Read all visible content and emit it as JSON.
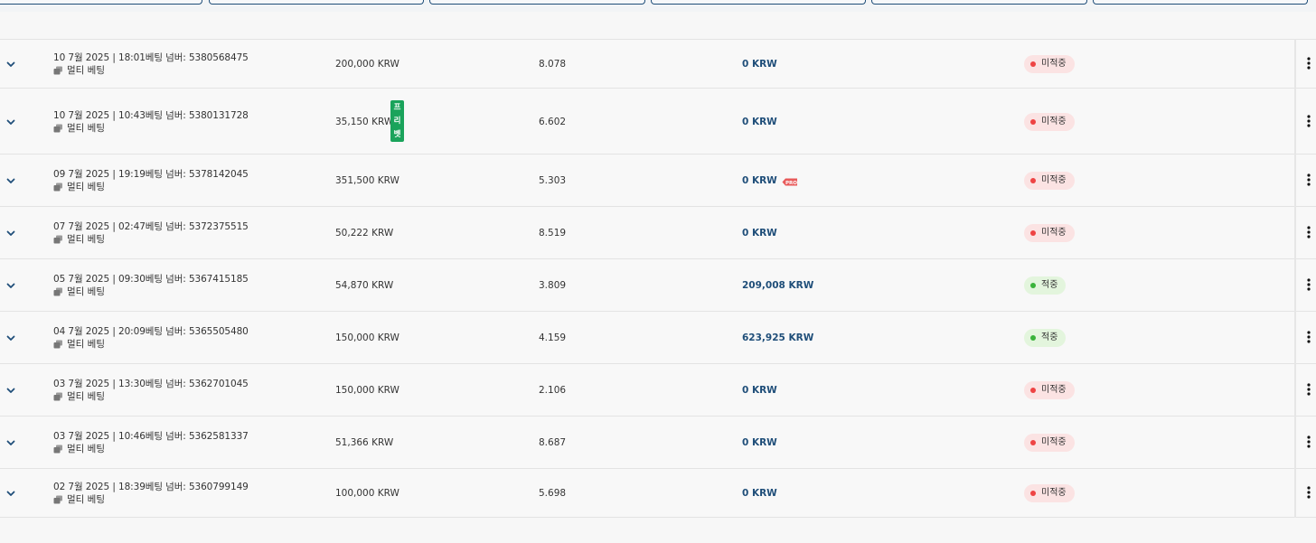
{
  "top_tabs": [
    "",
    "",
    "",
    "",
    "",
    ""
  ],
  "rows": [
    {
      "date": "10 7월 2025 | 18:01",
      "bet_no_label": "베팅 넘버:",
      "bet_no": "5380568475",
      "type": "멀티 베팅",
      "stake": "200,000 KRW",
      "odds": "8.078",
      "payout": "0 KRW",
      "status": "미적중",
      "result": "lose"
    },
    {
      "date": "10 7월 2025 | 10:43",
      "bet_no_label": "베팅 넘버:",
      "bet_no": "5380131728",
      "type": "멀티 베팅",
      "stake": "35,150 KRW",
      "odds": "6.602",
      "payout": "0 KRW",
      "status": "미적중",
      "result": "lose",
      "freebet": [
        "프",
        "리",
        "벳"
      ]
    },
    {
      "date": "09 7월 2025 | 19:19",
      "bet_no_label": "베팅 넘버:",
      "bet_no": "5378142045",
      "type": "멀티 베팅",
      "stake": "351,500 KRW",
      "odds": "5.303",
      "payout": "0 KRW",
      "status": "미적중",
      "result": "lose",
      "payout_tag": "PRO"
    },
    {
      "date": "07 7월 2025 | 02:47",
      "bet_no_label": "베팅 넘버:",
      "bet_no": "5372375515",
      "type": "멀티 베팅",
      "stake": "50,222 KRW",
      "odds": "8.519",
      "payout": "0 KRW",
      "status": "미적중",
      "result": "lose"
    },
    {
      "date": "05 7월 2025 | 09:30",
      "bet_no_label": "베팅 넘버:",
      "bet_no": "5367415185",
      "type": "멀티 베팅",
      "stake": "54,870 KRW",
      "odds": "3.809",
      "payout": "209,008 KRW",
      "status": "적중",
      "result": "win"
    },
    {
      "date": "04 7월 2025 | 20:09",
      "bet_no_label": "베팅 넘버:",
      "bet_no": "5365505480",
      "type": "멀티 베팅",
      "stake": "150,000 KRW",
      "odds": "4.159",
      "payout": "623,925 KRW",
      "status": "적중",
      "result": "win"
    },
    {
      "date": "03 7월 2025 | 13:30",
      "bet_no_label": "베팅 넘버:",
      "bet_no": "5362701045",
      "type": "멀티 베팅",
      "stake": "150,000 KRW",
      "odds": "2.106",
      "payout": "0 KRW",
      "status": "미적중",
      "result": "lose"
    },
    {
      "date": "03 7월 2025 | 10:46",
      "bet_no_label": "베팅 넘버:",
      "bet_no": "5362581337",
      "type": "멀티 베팅",
      "stake": "51,366 KRW",
      "odds": "8.687",
      "payout": "0 KRW",
      "status": "미적중",
      "result": "lose"
    },
    {
      "date": "02 7월 2025 | 18:39",
      "bet_no_label": "베팅 넘버:",
      "bet_no": "5360799149",
      "type": "멀티 베팅",
      "stake": "100,000 KRW",
      "odds": "5.698",
      "payout": "0 KRW",
      "status": "미적중",
      "result": "lose"
    }
  ],
  "icons": {
    "expand": "chevron-down-icon",
    "multi": "multi-bet-icon",
    "menu": "more-vertical-icon",
    "tag": "pro-tag-icon"
  },
  "colors": {
    "payout": "#1f4e79",
    "lose": "#ee4444",
    "win": "#3bb33b",
    "freebet": "#1aa35b"
  }
}
